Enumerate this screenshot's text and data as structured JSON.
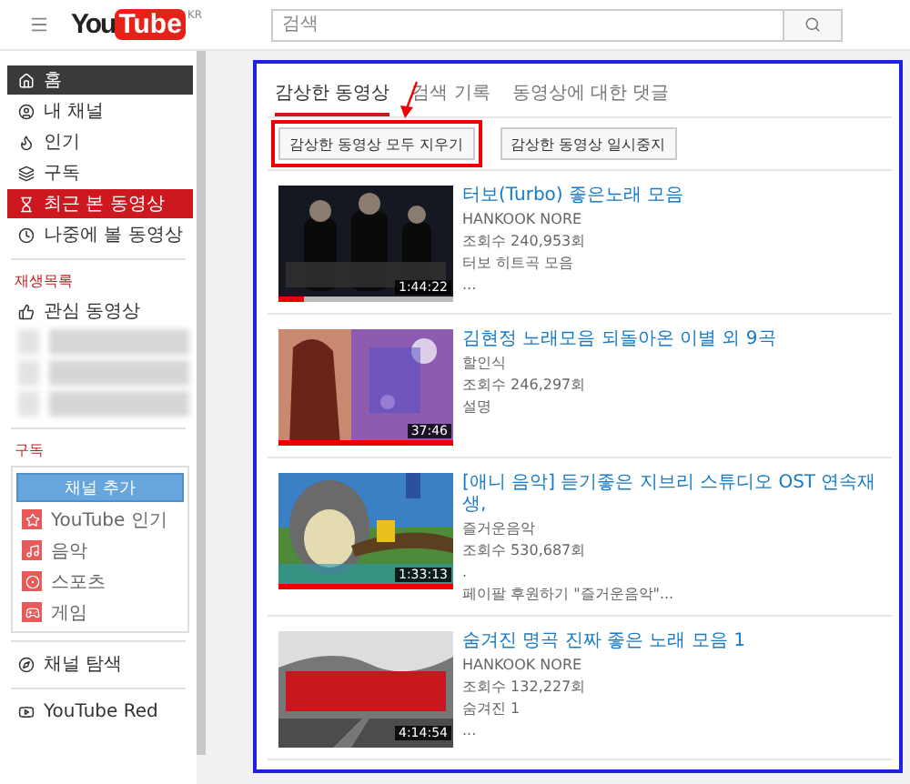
{
  "header": {
    "logo_you": "You",
    "logo_tube": "Tube",
    "region": "KR",
    "search": {
      "placeholder": "검색"
    }
  },
  "sidebar": {
    "nav": [
      {
        "label": "홈",
        "selected": false,
        "kind": "dark"
      },
      {
        "label": "내 채널",
        "selected": false,
        "kind": "plain"
      },
      {
        "label": "인기",
        "selected": false,
        "kind": "plain"
      },
      {
        "label": "구독",
        "selected": false,
        "kind": "plain"
      },
      {
        "label": "최근 본 동영상",
        "selected": true,
        "kind": "plain"
      },
      {
        "label": "나중에 볼 동영상",
        "selected": false,
        "kind": "plain"
      }
    ],
    "playlists_heading": "재생목록",
    "playlists": [
      {
        "kind": "link",
        "label": "관심 동영상"
      },
      {
        "kind": "blurred"
      },
      {
        "kind": "blurred"
      },
      {
        "kind": "blurred"
      }
    ],
    "subscriptions_heading": "구독",
    "add_channel": "채널 추가",
    "subscriptions": [
      {
        "label": "YouTube 인기"
      },
      {
        "label": "음악"
      },
      {
        "label": "스포츠"
      },
      {
        "label": "게임"
      }
    ],
    "more": [
      {
        "label": "채널 탐색"
      },
      {
        "label": "YouTube Red"
      }
    ]
  },
  "tabs": [
    {
      "label": "감상한 동영상",
      "selected": true
    },
    {
      "label": "검색 기록",
      "selected": false
    },
    {
      "label": "동영상에 대한 댓글",
      "selected": false
    }
  ],
  "actions": [
    {
      "label": "감상한 동영상 모두 지우기",
      "highlighted": true
    },
    {
      "label": "감상한 동영상 일시중지",
      "highlighted": false
    }
  ],
  "videos": [
    {
      "title": "터보(Turbo) 좋은노래 모음",
      "channel": "HANKOOK NORE",
      "views": "조회수 240,953회",
      "description": [
        "터보 히트곡 모음",
        "..."
      ],
      "duration": "1:44:22",
      "level": 0.15
    },
    {
      "title": "김현정 노래모음 되돌아온 이별 외 9곡",
      "channel": "할인식",
      "views": "조회수 246,297회",
      "description": [
        "설명"
      ],
      "duration": "37:46",
      "level": 1
    },
    {
      "title": "[애니 음악] 듣기좋은 지브리 스튜디오 OST 연속재생,",
      "channel": "즐거운음악",
      "views": "조회수 530,687회",
      "description": [
        ".",
        "페이팔 후원하기 \"즐거운음악\"..."
      ],
      "duration": "1:33:13",
      "level": 1
    },
    {
      "title": "숨겨진 명곡 진짜 좋은 노래 모음 1",
      "channel": "HANKOOK NORE",
      "views": "조회수 132,227회",
      "description": [
        "숨겨진 1",
        "..."
      ],
      "duration": "4:14:54"
    }
  ]
}
